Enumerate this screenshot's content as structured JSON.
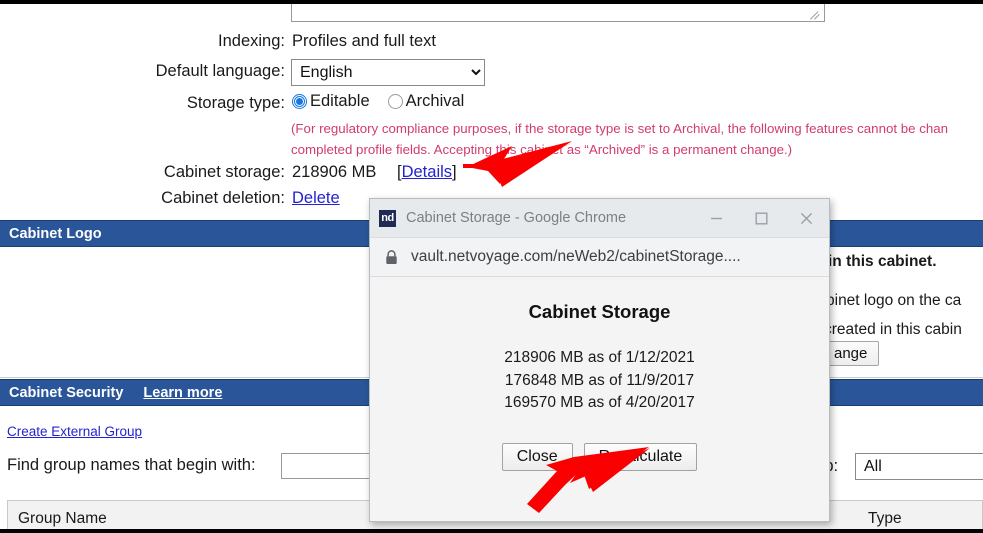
{
  "form": {
    "rows": [
      {
        "label": "Indexing:",
        "value": "Profiles and full text"
      },
      {
        "label": "Default language:",
        "value": "English"
      },
      {
        "label": "Storage type:",
        "value": ""
      },
      {
        "label": "Cabinet storage:",
        "value": "218906 MB"
      },
      {
        "label": "Cabinet deletion:",
        "value": "Delete"
      }
    ],
    "language_selected": "English",
    "language_options": [
      "English"
    ],
    "storage_type": {
      "editable_label": "Editable",
      "archival_label": "Archival",
      "selected": "Editable"
    },
    "compliance_note_line1": "(For regulatory compliance purposes, if the storage type is set to Archival, the following features cannot be chan",
    "compliance_note_line2": "completed profile fields. Accepting this cabinet as “Archived” is a permanent change.)",
    "cabinet_storage_value": "218906 MB",
    "details_link": "[Details]",
    "details_link_text": "Details",
    "delete_link": "Delete"
  },
  "cabinet_logo": {
    "section_title": "Cabinet Logo",
    "line1": "in this cabinet.",
    "line2": "binet logo on the ca",
    "line3": "created in this cabin",
    "change_button": "ange"
  },
  "cabinet_security": {
    "section_title": "Cabinet Security",
    "learn_more": "Learn more",
    "create_external_group": "Create External Group",
    "find_label": "Find group names that begin with:",
    "find_value": "",
    "group_label": "oup:",
    "group_selected": "All",
    "group_options": [
      "All"
    ],
    "table_headers": [
      "Group Name",
      "Type"
    ]
  },
  "popup": {
    "favicon_text": "nd",
    "window_title": "Cabinet Storage - Google Chrome",
    "url": "vault.netvoyage.com/neWeb2/cabinetStorage....",
    "url_domain": "vault.netvoyage.com",
    "url_path": "/neWeb2/cabinetStorage....",
    "heading": "Cabinet Storage",
    "storage_history": [
      "218906 MB as of 1/12/2021",
      "176848 MB as of 11/9/2017",
      "169570 MB as of 4/20/2017"
    ],
    "close_button": "Close",
    "recalculate_button": "Recalculate",
    "minimize_icon": "minimize-icon",
    "maximize_icon": "maximize-icon",
    "close_icon": "close-icon",
    "lock_icon": "lock-icon"
  },
  "annotations": {
    "arrow_color": "#fa0000",
    "arrow_1_target": "details-link",
    "arrow_2_target": "recalculate-button"
  },
  "colors": {
    "section_header_bg": "#2a5699",
    "link": "#2323cf",
    "compliance_text": "#d23b6e",
    "arrow": "#fa0000"
  }
}
